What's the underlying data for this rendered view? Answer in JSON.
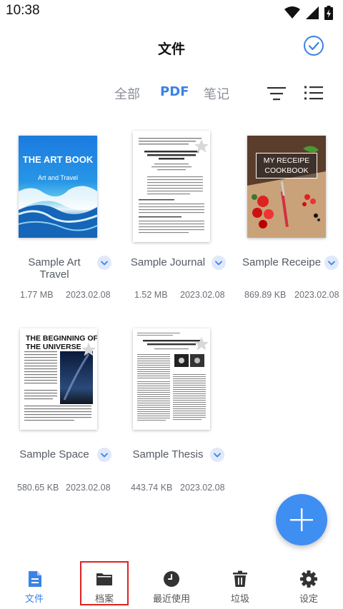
{
  "status_bar": {
    "time": "10:38"
  },
  "header": {
    "title": "文件"
  },
  "tabs": [
    {
      "label": "全部",
      "active": false
    },
    {
      "label": "PDF",
      "active": true
    },
    {
      "label": "笔记",
      "active": false
    }
  ],
  "files": [
    {
      "name": "Sample Art Travel",
      "name_line1": "Sample Art",
      "name_line2": "Travel",
      "size": "1.77 MB",
      "date": "2023.02.08",
      "cover_title": "THE ART BOOK",
      "cover_subtitle": "Art and Travel"
    },
    {
      "name": "Sample Journal",
      "size": "1.52 MB",
      "date": "2023.02.08"
    },
    {
      "name": "Sample Receipe",
      "size": "869.89 KB",
      "date": "2023.02.08",
      "cover_title_1": "MY RECEIPE",
      "cover_title_2": "COOKBOOK"
    },
    {
      "name": "Sample Space",
      "size": "580.65 KB",
      "date": "2023.02.08",
      "cover_title_1": "THE BEGINNING OF",
      "cover_title_2": "THE UNIVERSE"
    },
    {
      "name": "Sample Thesis",
      "size": "443.74 KB",
      "date": "2023.02.08"
    }
  ],
  "bottom_nav": [
    {
      "label": "文件",
      "icon": "document-icon",
      "active": true
    },
    {
      "label": "档案",
      "icon": "folder-icon",
      "active": false
    },
    {
      "label": "最近使用",
      "icon": "clock-icon",
      "active": false
    },
    {
      "label": "垃圾",
      "icon": "trash-icon",
      "active": false
    },
    {
      "label": "设定",
      "icon": "gear-icon",
      "active": false
    }
  ],
  "colors": {
    "accent": "#3b82e6",
    "fab": "#3f8ef2",
    "highlight": "#e02020"
  }
}
